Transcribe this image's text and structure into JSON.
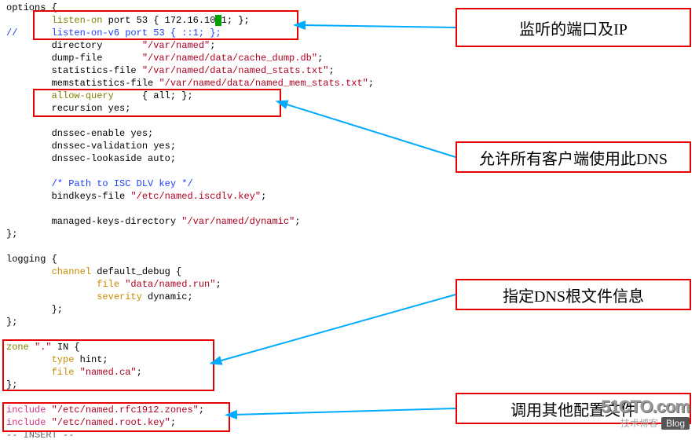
{
  "code": {
    "l0": "options {",
    "l1a": "        ",
    "l1b": "listen-on",
    "l1c": " port 53 { 172.16.10",
    "l1cursor": ".",
    "l1d": "1; };",
    "l2a": "//      ",
    "l2b": "listen-on-v6",
    "l2c": " port 53 { ::1; };",
    "l3a": "        directory       ",
    "l3b": "\"/var/named\"",
    "l3c": ";",
    "l4a": "        dump-file       ",
    "l4b": "\"/var/named/data/cache_dump.db\"",
    "l4c": ";",
    "l5a": "        statistics-file ",
    "l5b": "\"/var/named/data/named_stats.txt\"",
    "l5c": ";",
    "l6a": "        memstatistics-file ",
    "l6b": "\"/var/named/data/named_mem_stats.txt\"",
    "l6c": ";",
    "l7a": "        ",
    "l7b": "allow-query",
    "l7c": "     { all; };",
    "l8a": "        recursion yes;",
    "l9": "",
    "l10": "        dnssec-enable yes;",
    "l11": "        dnssec-validation yes;",
    "l12": "        dnssec-lookaside auto;",
    "l13": "",
    "l14a": "        ",
    "l14b": "/* Path to ISC DLV key */",
    "l15a": "        bindkeys-file ",
    "l15b": "\"/etc/named.iscdlv.key\"",
    "l15c": ";",
    "l16": "",
    "l17a": "        managed-keys-directory ",
    "l17b": "\"/var/named/dynamic\"",
    "l17c": ";",
    "l18": "};",
    "l19": "",
    "l20": "logging {",
    "l21a": "        ",
    "l21b": "channel",
    "l21c": " default_debug {",
    "l22a": "                ",
    "l22b": "file",
    "l22c": " ",
    "l22d": "\"data/named.run\"",
    "l22e": ";",
    "l23a": "                ",
    "l23b": "severity",
    "l23c": " dynamic;",
    "l24": "        };",
    "l25": "};",
    "l26": "",
    "l27a": "zone",
    "l27b": " ",
    "l27c": "\".\"",
    "l27d": " IN {",
    "l28a": "        ",
    "l28b": "type",
    "l28c": " hint;",
    "l29a": "        ",
    "l29b": "file",
    "l29c": " ",
    "l29d": "\"named.ca\"",
    "l29e": ";",
    "l30": "};",
    "l31": "",
    "l32a": "include",
    "l32b": " ",
    "l32c": "\"/etc/named.rfc1912.zones\"",
    "l32d": ";",
    "l33a": "include",
    "l33b": " ",
    "l33c": "\"/etc/named.root.key\"",
    "l33d": ";",
    "l34": "-- INSERT --"
  },
  "callouts": {
    "c1": "监听的端口及IP",
    "c2": "允许所有客户端使用此DNS",
    "c3": "指定DNS根文件信息",
    "c4": "调用其他配置文件"
  },
  "watermark": {
    "main": "51CTO.com",
    "sub": "技术博客",
    "badge": "Blog"
  }
}
